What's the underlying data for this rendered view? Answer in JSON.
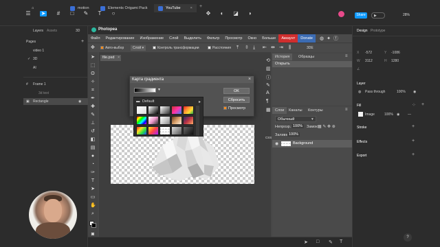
{
  "figma": {
    "tabs": [
      {
        "label": "Home"
      },
      {
        "label": "motion"
      },
      {
        "label": "Elements Origami Pack"
      },
      {
        "label": "YouTube"
      }
    ],
    "share_label": "Share",
    "zoom": "28%",
    "left_panel": {
      "tab_layers": "Layers",
      "tab_assets": "Assets",
      "mode": "3D",
      "pages_label": "Pages",
      "pages": [
        "video 1",
        "3D",
        "AI"
      ],
      "layers": [
        "Rectangle",
        "Frame 1",
        "3d text"
      ]
    },
    "right_panel": {
      "tab_design": "Design",
      "tab_prototype": "Prototype",
      "x_label": "X",
      "x_value": "-572",
      "y_label": "Y",
      "y_value": "-1086",
      "w_label": "W",
      "w_value": "3112",
      "h_label": "H",
      "h_value": "1280",
      "layer_section": "Layer",
      "pass_through": "Pass through",
      "pass_opacity": "100%",
      "fill_section": "Fill",
      "fill_type": "Image",
      "fill_opacity": "100%",
      "stroke_section": "Stroke",
      "effects_section": "Effects",
      "export_section": "Export"
    }
  },
  "photopea": {
    "app_name": "Photopea",
    "menu": [
      "Файл",
      "Редактирование",
      "Изображение",
      "Слой",
      "Выделить",
      "Фильтр",
      "Просмотр",
      "Окно",
      "Больше"
    ],
    "menu_account": "Аккаунт",
    "menu_donate": "Donate",
    "options": {
      "auto_select": "Авто-выбор",
      "layer_select": "Слой",
      "transform_controls": "Контроль трансформации",
      "distances": "Расстояния",
      "mode_3d": "3DE"
    },
    "doc_tab": "file.psd",
    "history_tabs": [
      "История",
      "Образцы"
    ],
    "history_item": "Открыть",
    "layers_tabs": [
      "Слои",
      "Каналы",
      "Контуры"
    ],
    "blend_mode": "Обычный",
    "opacity_label": "Непрозр.:",
    "opacity_value": "100%",
    "lock_label": "Замок:",
    "fill_label": "Заливка:",
    "fill_value": "100%",
    "layer_name": "Background",
    "side_labels": [
      "CSS"
    ],
    "dialog": {
      "title": "Карта градиента",
      "ok": "OK",
      "reset": "Сбросить",
      "preview": "Просмотр",
      "preset_folder": "Default"
    }
  }
}
